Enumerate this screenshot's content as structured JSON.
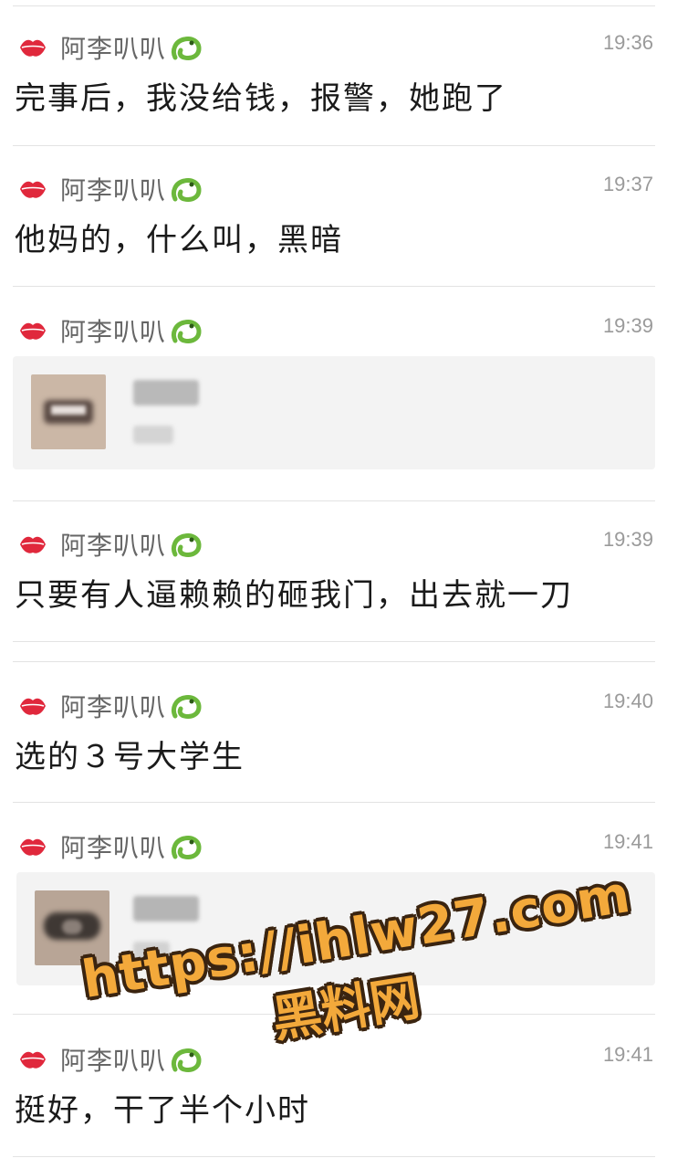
{
  "sender": "阿李叭叭",
  "messages": [
    {
      "type": "text",
      "time": "19:36",
      "text": "完事后，我没给钱，报警，她跑了"
    },
    {
      "type": "text",
      "time": "19:37",
      "text": "他妈的，什么叫，黑暗"
    },
    {
      "type": "card",
      "time": "19:39"
    },
    {
      "type": "text",
      "time": "19:39",
      "text": "只要有人逼赖赖的砸我门，出去就一刀"
    },
    {
      "type": "text",
      "time": "19:40",
      "text": "选的３号大学生"
    },
    {
      "type": "card",
      "time": "19:41"
    },
    {
      "type": "text",
      "time": "19:41",
      "text": "挺好，干了半个小时"
    }
  ],
  "watermark": {
    "url": "https://ihlw27.com",
    "label": "黑料网"
  },
  "colors": {
    "lips": "#e0283c",
    "crocodile": "#6cb83c",
    "watermark_fill": "#f3a93b",
    "watermark_outline": "#3a2410"
  },
  "icons": [
    "lips-icon",
    "crocodile-icon"
  ]
}
